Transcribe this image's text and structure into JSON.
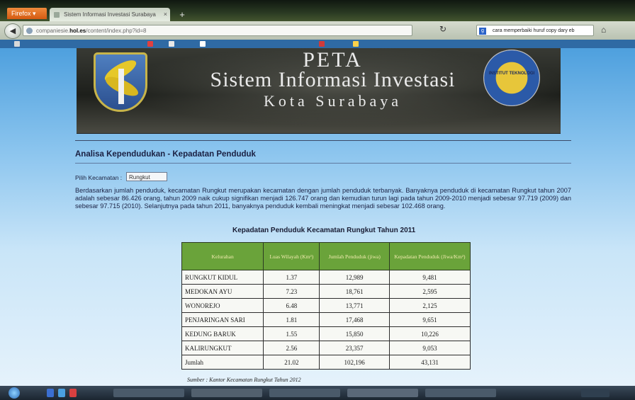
{
  "browser": {
    "menu_label": "Firefox ▾",
    "tab_title": "Sistem Informasi Investasi Surabaya",
    "new_tab": "+",
    "url_prefix": "companiesie.",
    "url_host": "hol.es",
    "url_rest": "/content/index.php?id=8",
    "search_engine_icon": "google-icon",
    "search_text": "cara memperbaiki huruf copy dary eb"
  },
  "banner": {
    "title": "PETA",
    "subtitle": "Sistem Informasi Investasi",
    "city": "Kota Surabaya",
    "seal_text": "INSTITUT TEKNOLOGI"
  },
  "content": {
    "heading": "Analisa Kependudukan - Kepadatan Penduduk",
    "filter_label": "Pilih Kecamatan :",
    "filter_value": "Rungkut",
    "paragraph": "Berdasarkan jumlah penduduk, kecamatan Rungkut merupakan kecamatan dengan jumlah penduduk terbanyak. Banyaknya penduduk di kecamatan Rungkut tahun 2007 adalah sebesar 86.426 orang, tahun 2009 naik cukup signifikan menjadi 126.747 orang dan kemudian turun lagi pada tahun 2009-2010 menjadi sebesar 97.719 (2009) dan sebesar 97.715 (2010). Selanjutnya pada tahun 2011, banyaknya penduduk kembali meningkat menjadi sebesar 102.468 orang.",
    "table_title": "Kepadatan Penduduk Kecamatan Rungkut Tahun 2011",
    "table": {
      "headers": [
        "Kelurahan",
        "Luas Wilayah (Km²)",
        "Jumlah Penduduk (jiwa)",
        "Kepadatan Penduduk (Jiwa/Km²)"
      ],
      "rows": [
        [
          "RUNGKUT KIDUL",
          "1.37",
          "12,989",
          "9,481"
        ],
        [
          "MEDOKAN AYU",
          "7.23",
          "18,761",
          "2,595"
        ],
        [
          "WONOREJO",
          "6.48",
          "13,771",
          "2,125"
        ],
        [
          "PENJARINGAN SARI",
          "1.81",
          "17,468",
          "9,651"
        ],
        [
          "KEDUNG BARUK",
          "1.55",
          "15,850",
          "10,226"
        ],
        [
          "KALIRUNGKUT",
          "2.56",
          "23,357",
          "9,053"
        ],
        [
          "Jumlah",
          "21.02",
          "102,196",
          "43,131"
        ]
      ]
    },
    "source": "Sumber : Kantor Kecamatan Rungkut Tahun 2012"
  },
  "colors": {
    "table_header_bg": "#6aa33a",
    "page_bg_top": "#4ea0de",
    "heading_color": "#1a2042"
  }
}
